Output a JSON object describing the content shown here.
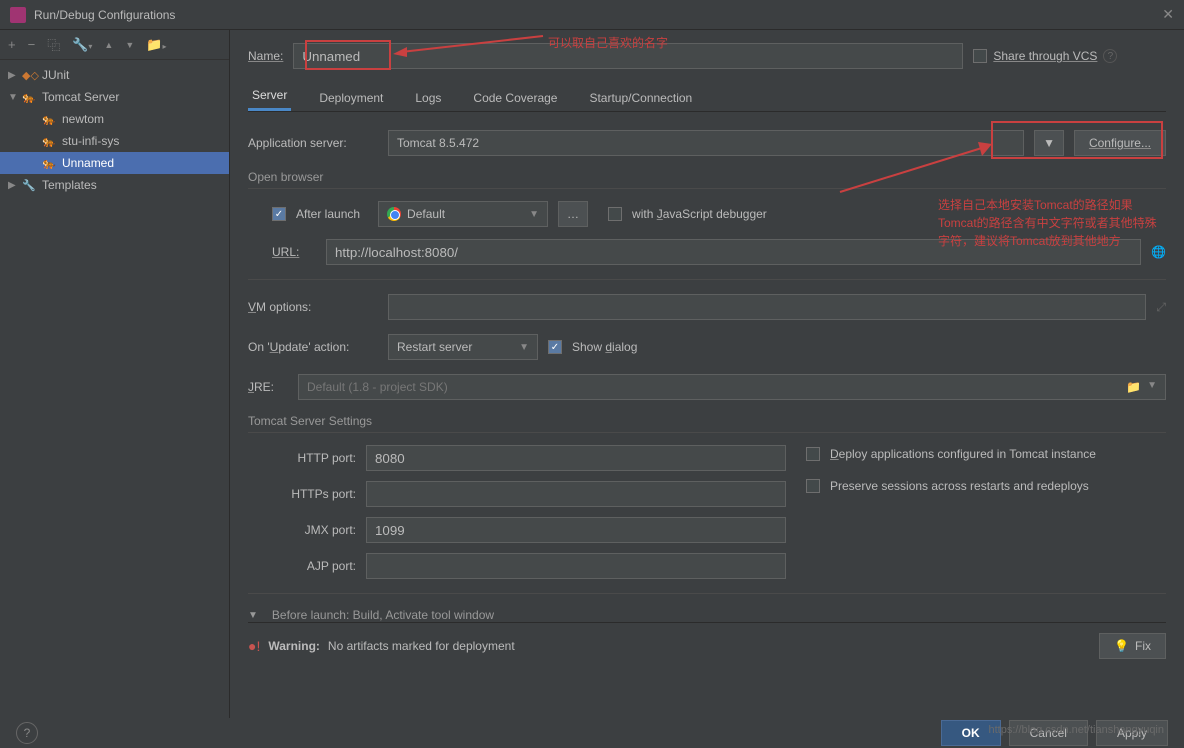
{
  "window": {
    "title": "Run/Debug Configurations"
  },
  "toolbar": {
    "add": "+",
    "remove": "−",
    "copy": "⿻",
    "wrench": "🔧",
    "up": "▲",
    "down": "▼",
    "folder": "📁"
  },
  "tree": {
    "junit": "JUnit",
    "tomcat_server": "Tomcat Server",
    "newtom": "newtom",
    "stu_infi_sys": "stu-infi-sys",
    "unnamed": "Unnamed",
    "templates": "Templates"
  },
  "name": {
    "label": "Name:",
    "value": "Unnamed"
  },
  "share": {
    "label": "Share through VCS"
  },
  "tabs": {
    "server": "Server",
    "deployment": "Deployment",
    "logs": "Logs",
    "coverage": "Code Coverage",
    "startup": "Startup/Connection"
  },
  "form": {
    "app_server_label": "Application server:",
    "app_server_value": "Tomcat 8.5.472",
    "configure": "Configure...",
    "open_browser": "Open browser",
    "after_launch": "After launch",
    "browser": "Default",
    "js_debugger": "with JavaScript debugger",
    "url_label": "URL:",
    "url_value": "http://localhost:8080/",
    "vm_options": "VM options:",
    "on_update": "On 'Update' action:",
    "restart_server": "Restart server",
    "show_dialog": "Show dialog",
    "jre_label": "JRE:",
    "jre_value": "Default (1.8 - project SDK)",
    "tomcat_settings": "Tomcat Server Settings",
    "http_port": "HTTP port:",
    "http_port_value": "8080",
    "https_port": "HTTPs port:",
    "jmx_port": "JMX port:",
    "jmx_port_value": "1099",
    "ajp_port": "AJP port:",
    "deploy_apps": "Deploy applications configured in Tomcat instance",
    "preserve_sessions": "Preserve sessions across restarts and redeploys",
    "before_launch": "Before launch: Build, Activate tool window"
  },
  "warning": {
    "label": "Warning:",
    "text": "No artifacts marked for deployment",
    "fix": "Fix"
  },
  "footer": {
    "ok": "OK",
    "cancel": "Cancel",
    "apply": "Apply"
  },
  "annotations": {
    "name_hint": "可以取自己喜欢的名字",
    "server_hint": "选择自己本地安装Tomcat的路径如果Tomcat的路径含有中文字符或者其他特殊字符，建议将Tomcat放到其他地方"
  },
  "watermark": "https://blog.csdn.net/tianshangyuqin"
}
